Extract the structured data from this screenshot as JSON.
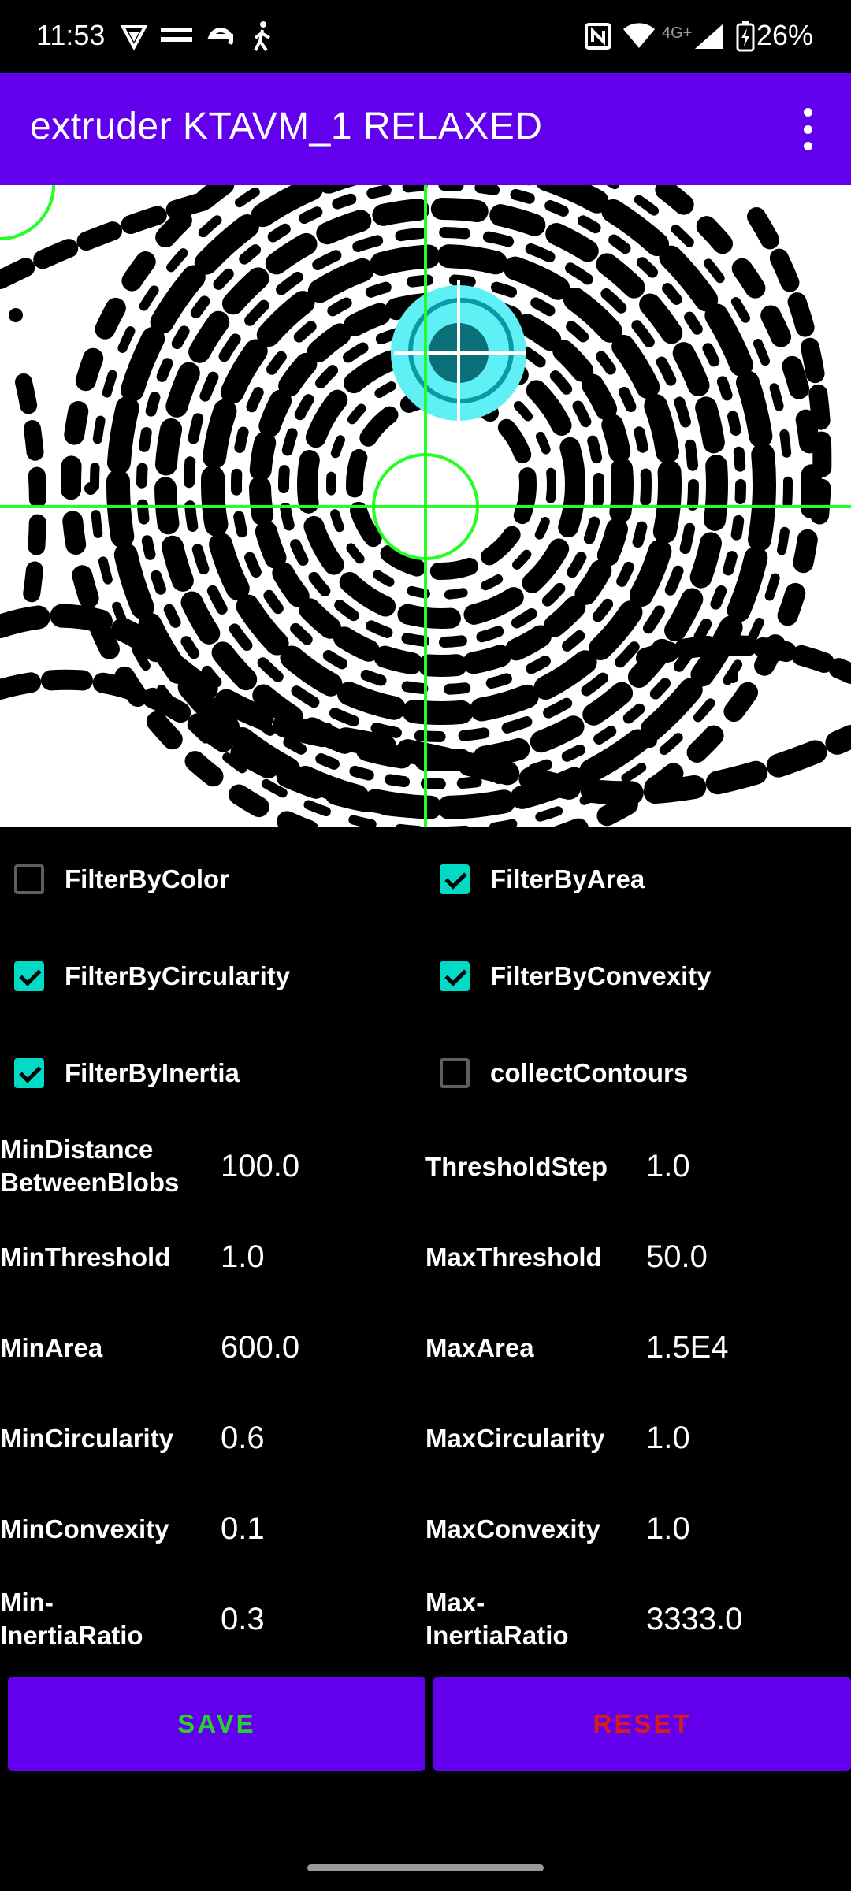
{
  "status_bar": {
    "time": "11:53",
    "notification_icons": [
      "vpn-shield-icon",
      "twente-milieu-icon",
      "e-app-icon",
      "accessibility-icon"
    ],
    "system_icons": [
      "nfc-icon",
      "wifi-icon",
      "signal-4g-icon",
      "battery-charging-icon"
    ],
    "network_label": "4G+",
    "battery": "26%"
  },
  "app_bar": {
    "title": "extruder KTAVM_1 RELAXED",
    "menu_icon": "more-vert-icon"
  },
  "preview": {
    "description_icon": "camera-preview",
    "crosshair_color": "#22ff22",
    "detected_blob_color": "#5ff0f5"
  },
  "filters": {
    "filter_by_color": {
      "label": "FilterByColor",
      "checked": false
    },
    "filter_by_area": {
      "label": "FilterByArea",
      "checked": true
    },
    "filter_by_circularity": {
      "label": "FilterByCircularity",
      "checked": true
    },
    "filter_by_convexity": {
      "label": "FilterByConvexity",
      "checked": true
    },
    "filter_by_inertia": {
      "label": "FilterByInertia",
      "checked": true
    },
    "collect_contours": {
      "label": "collectContours",
      "checked": false
    }
  },
  "params": {
    "min_distance": {
      "label_line1": "MinDistance",
      "label_line2": "BetweenBlobs",
      "value": "100.0"
    },
    "threshold_step": {
      "label": "ThresholdStep",
      "value": "1.0"
    },
    "min_threshold": {
      "label": "MinThreshold",
      "value": "1.0"
    },
    "max_threshold": {
      "label": "MaxThreshold",
      "value": "50.0"
    },
    "min_area": {
      "label": "MinArea",
      "value": "600.0"
    },
    "max_area": {
      "label": "MaxArea",
      "value": "1.5E4"
    },
    "min_circularity": {
      "label": "MinCircularity",
      "value": "0.6"
    },
    "max_circularity": {
      "label": "MaxCircularity",
      "value": "1.0"
    },
    "min_convexity": {
      "label": "MinConvexity",
      "value": "0.1"
    },
    "max_convexity": {
      "label": "MaxConvexity",
      "value": "1.0"
    },
    "min_inertia": {
      "label_line1": "Min-",
      "label_line2": "InertiaRatio",
      "value": "0.3"
    },
    "max_inertia": {
      "label_line1": "Max-",
      "label_line2": "InertiaRatio",
      "value": "3333.0"
    }
  },
  "buttons": {
    "save": {
      "label": "SAVE",
      "color": "#2bd12b"
    },
    "reset": {
      "label": "RESET",
      "color": "#d81b1b"
    }
  },
  "colors": {
    "primary": "#6200ee",
    "accent": "#03dac5"
  }
}
